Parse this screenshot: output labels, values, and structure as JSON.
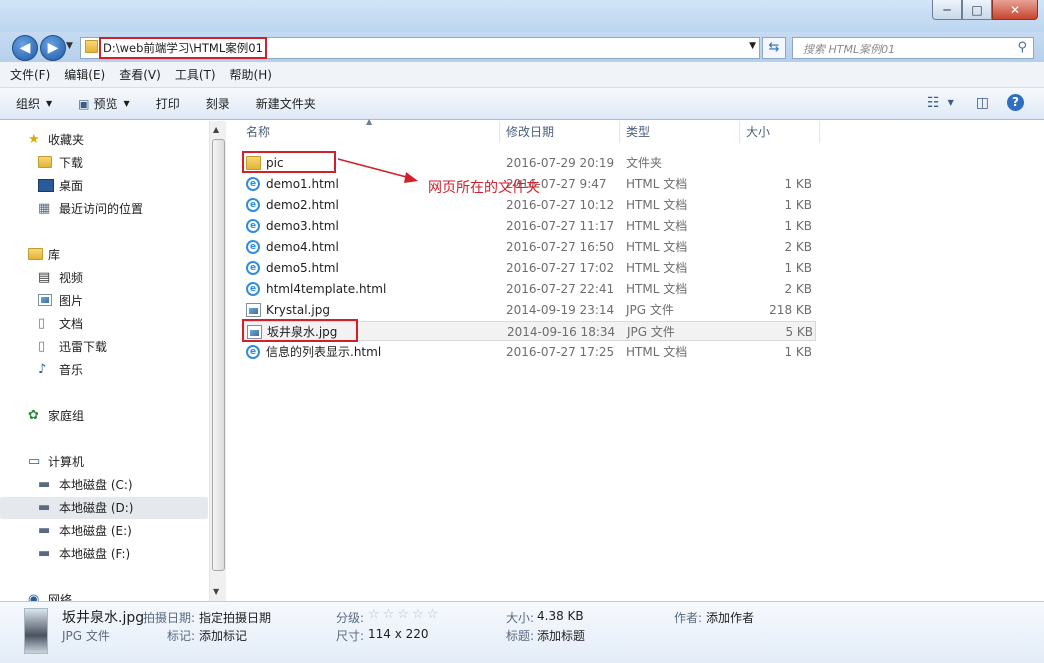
{
  "window": {
    "minimize_glyph": "─",
    "maximize_glyph": "□",
    "close_glyph": "✕"
  },
  "address": {
    "path": "D:\\web前端学习\\HTML案例01",
    "search_placeholder": "搜索 HTML案例01"
  },
  "menu": [
    "文件(F)",
    "编辑(E)",
    "查看(V)",
    "工具(T)",
    "帮助(H)"
  ],
  "toolbar": {
    "organize": "组织",
    "preview": "预览",
    "print": "打印",
    "burn": "刻录",
    "new_folder": "新建文件夹"
  },
  "nav": {
    "favorites": "收藏夹",
    "downloads": "下载",
    "desktop": "桌面",
    "recent": "最近访问的位置",
    "libraries": "库",
    "videos": "视频",
    "pictures": "图片",
    "documents": "文档",
    "xunlei": "迅雷下载",
    "music": "音乐",
    "homegroup": "家庭组",
    "computer": "计算机",
    "drive_c": "本地磁盘 (C:)",
    "drive_d": "本地磁盘 (D:)",
    "drive_e": "本地磁盘 (E:)",
    "drive_f": "本地磁盘 (F:)",
    "network": "网络"
  },
  "columns": {
    "name": "名称",
    "date": "修改日期",
    "type": "类型",
    "size": "大小"
  },
  "files": [
    {
      "name": "pic",
      "date": "2016-07-29 20:19",
      "type": "文件夹",
      "size": "",
      "icon": "folder-icon"
    },
    {
      "name": "demo1.html",
      "date": "2016-07-27 9:47",
      "type": "HTML 文档",
      "size": "1 KB",
      "icon": "ie-icon"
    },
    {
      "name": "demo2.html",
      "date": "2016-07-27 10:12",
      "type": "HTML 文档",
      "size": "1 KB",
      "icon": "ie-icon"
    },
    {
      "name": "demo3.html",
      "date": "2016-07-27 11:17",
      "type": "HTML 文档",
      "size": "1 KB",
      "icon": "ie-icon"
    },
    {
      "name": "demo4.html",
      "date": "2016-07-27 16:50",
      "type": "HTML 文档",
      "size": "2 KB",
      "icon": "ie-icon"
    },
    {
      "name": "demo5.html",
      "date": "2016-07-27 17:02",
      "type": "HTML 文档",
      "size": "1 KB",
      "icon": "ie-icon"
    },
    {
      "name": "html4template.html",
      "date": "2016-07-27 22:41",
      "type": "HTML 文档",
      "size": "2 KB",
      "icon": "ie-icon"
    },
    {
      "name": "Krystal.jpg",
      "date": "2014-09-19 23:14",
      "type": "JPG 文件",
      "size": "218 KB",
      "icon": "image-icon"
    },
    {
      "name": "坂井泉水.jpg",
      "date": "2014-09-16 18:34",
      "type": "JPG 文件",
      "size": "5 KB",
      "icon": "image-icon"
    },
    {
      "name": "信息的列表显示.html",
      "date": "2016-07-27 17:25",
      "type": "HTML 文档",
      "size": "1 KB",
      "icon": "ie-icon"
    }
  ],
  "annotation": "网页所在的文件夹",
  "details": {
    "filename": "坂井泉水.jpg",
    "filetype": "JPG 文件",
    "date_taken_label": "拍摄日期:",
    "date_taken_value": "指定拍摄日期",
    "tags_label": "标记:",
    "tags_value": "添加标记",
    "rating_label": "分级:",
    "rating_stars": 0,
    "dims_label": "尺寸:",
    "dims_value": "114 x 220",
    "size_label": "大小:",
    "size_value": "4.38 KB",
    "title_label": "标题:",
    "title_value": "添加标题",
    "author_label": "作者:",
    "author_value": "添加作者"
  },
  "colors": {
    "highlight_red": "#d0202a",
    "title_bar": "#c6dbf2"
  }
}
